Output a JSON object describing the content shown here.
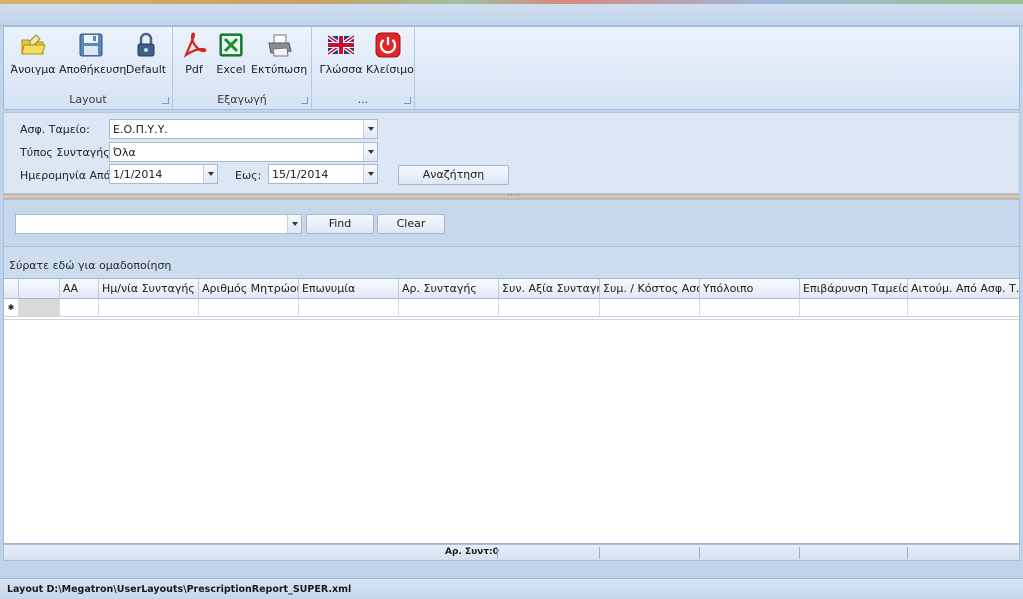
{
  "ribbon": {
    "groups": [
      {
        "label": "Layout",
        "buttons": [
          {
            "label": "Άνοιγμα",
            "icon": "open-folder-icon"
          },
          {
            "label": "Αποθήκευση",
            "icon": "save-disk-icon"
          },
          {
            "label": "Default",
            "icon": "lock-icon"
          }
        ]
      },
      {
        "label": "Εξαγωγή",
        "buttons": [
          {
            "label": "Pdf",
            "icon": "pdf-icon"
          },
          {
            "label": "Excel",
            "icon": "excel-icon"
          },
          {
            "label": "Εκτύπωση",
            "icon": "printer-icon"
          }
        ]
      },
      {
        "label": "...",
        "buttons": [
          {
            "label": "Γλώσσα",
            "icon": "uk-flag-icon"
          },
          {
            "label": "Κλείσιμο",
            "icon": "power-icon"
          }
        ]
      }
    ]
  },
  "filters": {
    "fund_label": "Ασφ. Ταμείο:",
    "fund_value": "Ε.Ο.Π.Υ.Υ.",
    "type_label": "Τύπος Συνταγής:",
    "type_value": "Όλα",
    "date_from_label": "Ημερομηνία Από:",
    "date_from_value": "1/1/2014",
    "date_to_label": "Εως:",
    "date_to_value": "15/1/2014",
    "search_button": "Αναζήτηση"
  },
  "findbar": {
    "search_value": "",
    "find_button": "Find",
    "clear_button": "Clear"
  },
  "grid": {
    "group_panel_text": "Σύρατε εδώ για ομαδοποίηση",
    "columns": [
      "ΑΑ",
      "Ημ/νία Συνταγής",
      "Αριθμός Μητρώου",
      "Επωνυμία",
      "Αρ. Συνταγής",
      "Συν. Αξία Συνταγής",
      "Συμ. / Κόστος Ασφ.",
      "Υπόλοιπο",
      "Επιβάρυνση Ταμείου",
      "Αιτούμ. Από Ασφ. Τ..."
    ],
    "new_row_indicator": "✱",
    "footer_count": "Αρ. Συντ:0"
  },
  "status": {
    "text": "Layout D:\\Megatron\\UserLayouts\\PrescriptionReport_SUPER.xml"
  }
}
